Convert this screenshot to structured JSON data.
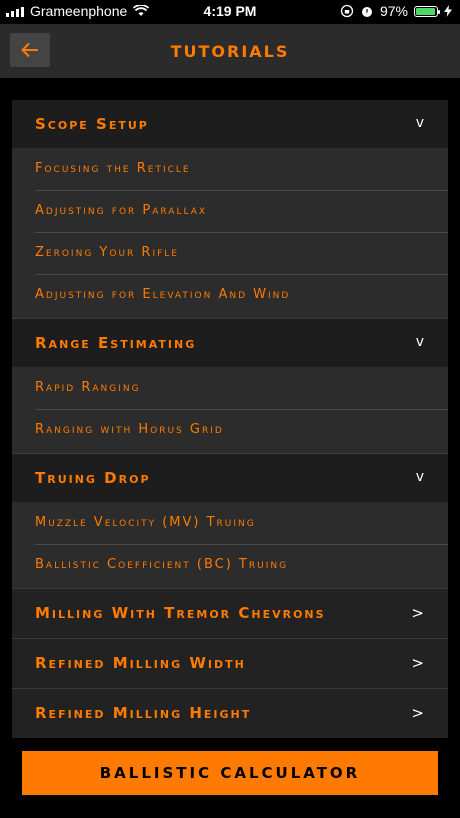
{
  "status": {
    "carrier": "Grameenphone",
    "time": "4:19 PM",
    "battery_text": "97%",
    "battery_level": 0.97
  },
  "header": {
    "title": "TUTORIALS"
  },
  "sections": [
    {
      "title": "Scope Setup",
      "chevron": "v",
      "items": [
        "Focusing the Reticle",
        "Adjusting for Parallax",
        "Zeroing Your Rifle",
        "Adjusting for Elevation And Wind"
      ]
    },
    {
      "title": "Range Estimating",
      "chevron": "v",
      "items": [
        "Rapid Ranging",
        "Ranging with Horus Grid"
      ]
    },
    {
      "title": "Truing Drop",
      "chevron": "v",
      "items": [
        "Muzzle Velocity (MV) Truing",
        "Ballistic Coefficient (BC) Truing"
      ]
    }
  ],
  "rows": [
    {
      "label": "Milling With Tremor Chevrons",
      "chevron": ">"
    },
    {
      "label": "Refined Milling Width",
      "chevron": ">"
    },
    {
      "label": "Refined Milling Height",
      "chevron": ">"
    }
  ],
  "calculator_button": "BALLISTIC CALCULATOR",
  "colors": {
    "accent": "#ff7a00",
    "background": "#000000",
    "header": "#2b2b2b"
  }
}
